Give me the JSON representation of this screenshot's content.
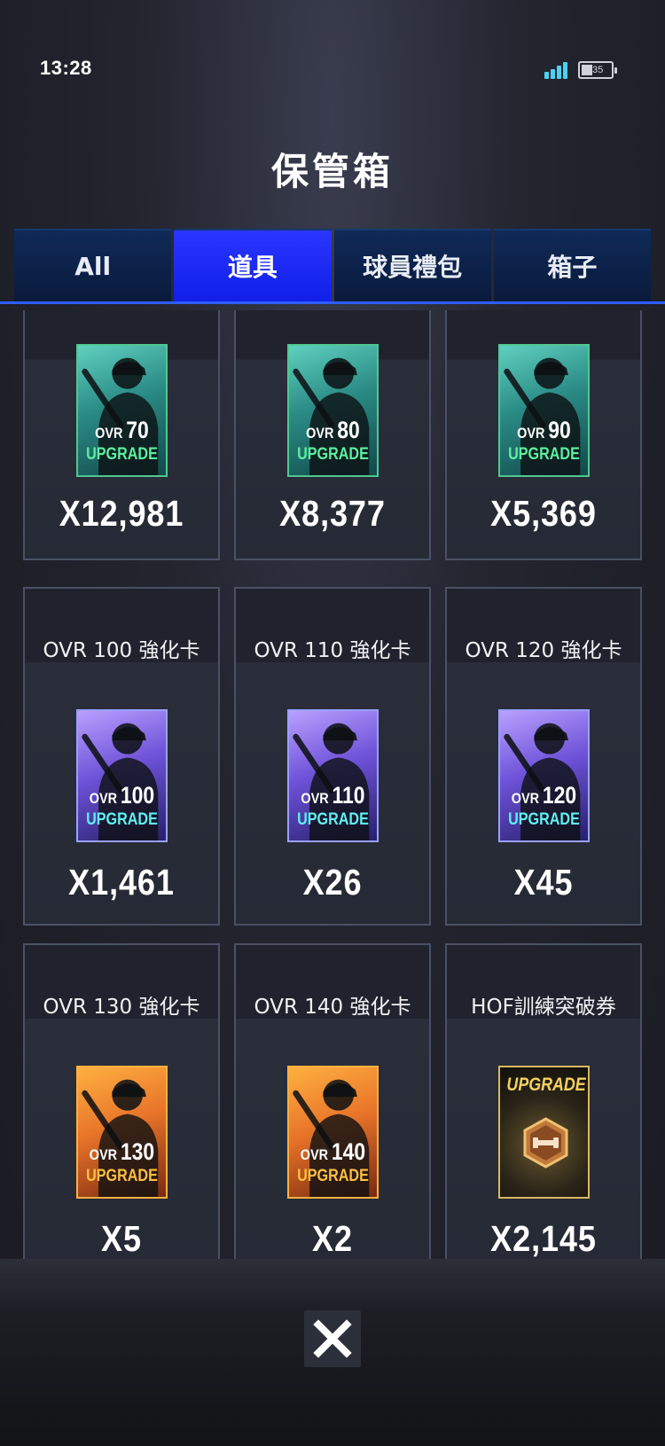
{
  "status_bar": {
    "time": "13:28",
    "battery": "35",
    "signal_icon": "signal-icon",
    "battery_icon": "battery-icon"
  },
  "page": {
    "title": "保管箱"
  },
  "tabs": [
    {
      "label": "All",
      "active": false
    },
    {
      "label": "道具",
      "active": true
    },
    {
      "label": "球員禮包",
      "active": false
    },
    {
      "label": "箱子",
      "active": false
    }
  ],
  "items": [
    {
      "name": "",
      "card_ovr": "70",
      "card_text": "UPGRADE",
      "count": "X12,981",
      "color": "green"
    },
    {
      "name": "",
      "card_ovr": "80",
      "card_text": "UPGRADE",
      "count": "X8,377",
      "color": "green"
    },
    {
      "name": "",
      "card_ovr": "90",
      "card_text": "UPGRADE",
      "count": "X5,369",
      "color": "green"
    },
    {
      "name": "OVR 100 強化卡",
      "card_ovr": "100",
      "card_text": "UPGRADE",
      "count": "X1,461",
      "color": "purple"
    },
    {
      "name": "OVR 110 強化卡",
      "card_ovr": "110",
      "card_text": "UPGRADE",
      "count": "X26",
      "color": "purple"
    },
    {
      "name": "OVR 120 強化卡",
      "card_ovr": "120",
      "card_text": "UPGRADE",
      "count": "X45",
      "color": "purple"
    },
    {
      "name": "OVR 130 強化卡",
      "card_ovr": "130",
      "card_text": "UPGRADE",
      "count": "X5",
      "color": "orange"
    },
    {
      "name": "OVR 140 強化卡",
      "card_ovr": "140",
      "card_text": "UPGRADE",
      "count": "X2",
      "color": "orange"
    },
    {
      "name": "HOF訓練突破券",
      "card_ovr": "",
      "card_text": "UPGRADE",
      "count": "X2,145",
      "color": "gold"
    }
  ],
  "card_prefix": "OVR",
  "close": {
    "icon": "close-icon"
  },
  "colors": {
    "tab_active": "#1a2cf5",
    "tab_inactive": "#0c2250",
    "accent_line": "#2f5eff"
  }
}
